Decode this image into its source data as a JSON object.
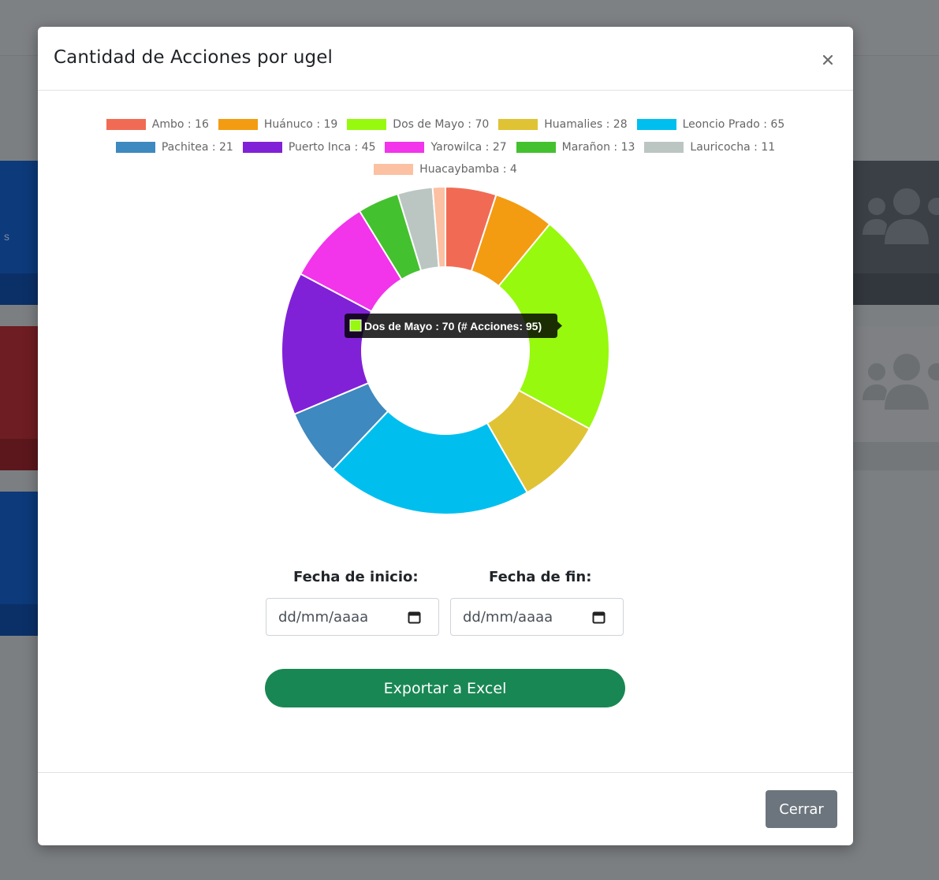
{
  "background": {
    "left_glyph": "s"
  },
  "modal": {
    "title": "Cantidad de Acciones por ugel",
    "close_icon": "close-icon"
  },
  "chart_data": {
    "type": "pie",
    "variant": "doughnut",
    "legend_position": "top",
    "series": [
      {
        "name": "Ambo",
        "value": 16,
        "label": "Ambo : 16",
        "color": "#f16b54"
      },
      {
        "name": "Huánuco",
        "value": 19,
        "label": "Huánuco : 19",
        "color": "#f39c12"
      },
      {
        "name": "Dos de Mayo",
        "value": 70,
        "label": "Dos de Mayo : 70",
        "color": "#97f90d"
      },
      {
        "name": "Huamalies",
        "value": 28,
        "label": "Huamalies : 28",
        "color": "#dfc334"
      },
      {
        "name": "Leoncio Prado",
        "value": 65,
        "label": "Leoncio Prado : 65",
        "color": "#00bfef"
      },
      {
        "name": "Pachitea",
        "value": 21,
        "label": "Pachitea : 21",
        "color": "#3e89bf"
      },
      {
        "name": "Puerto Inca",
        "value": 45,
        "label": "Puerto Inca : 45",
        "color": "#8121d7"
      },
      {
        "name": "Yarowilca",
        "value": 27,
        "label": "Yarowilca : 27",
        "color": "#f234eb"
      },
      {
        "name": "Marañon",
        "value": 13,
        "label": "Marañon : 13",
        "color": "#44c12f"
      },
      {
        "name": "Lauricocha",
        "value": 11,
        "label": "Lauricocha : 11",
        "color": "#bbc6c2"
      },
      {
        "name": "Huacaybamba",
        "value": 4,
        "label": "Huacaybamba : 4",
        "color": "#fcc0a2"
      }
    ],
    "legend_rows": [
      [
        0,
        1,
        2,
        3,
        4
      ],
      [
        5,
        6,
        7,
        8,
        9
      ],
      [
        10
      ]
    ],
    "tooltip": {
      "text": "Dos de Mayo : 70 (# Acciones: 95)",
      "color": "#97f90d"
    }
  },
  "filters": {
    "start_label": "Fecha de inicio:",
    "end_label": "Fecha de fin:",
    "start_placeholder": "dd/mm/aaaa",
    "end_placeholder": "dd/mm/aaaa",
    "calendar_icon": "calendar-icon"
  },
  "actions": {
    "export_label": "Exportar a Excel",
    "close_label": "Cerrar"
  }
}
